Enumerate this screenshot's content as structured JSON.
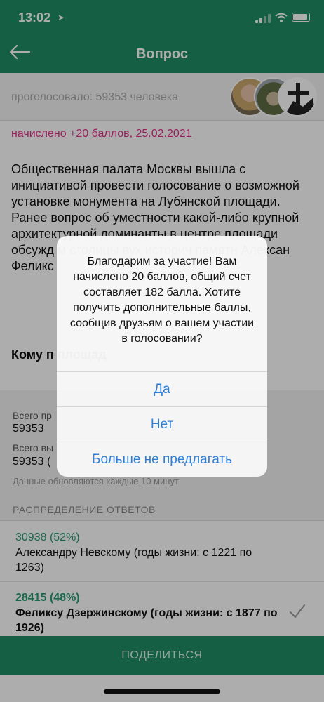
{
  "status": {
    "time": "13:02"
  },
  "nav": {
    "title": "Вопрос"
  },
  "voters": {
    "text": "проголосовало: 59353 человека"
  },
  "points": "начислено +20 баллов, 25.02.2021",
  "question": {
    "text": "Общественная палата Москвы вышла с инициативой провести голосование о возможной установке монумента на Лубянской площади. Ранее вопрос об уместности какой-либо крупной архитектурной доминанты в центре площади обсужд                                     м столицы                                      вух историч памятн Алексан Феликс",
    "bold": "Кому п площад"
  },
  "stats": {
    "label1": "Всего пр",
    "value1": "59353",
    "label2": "Всего вы",
    "value2": "59353 (",
    "note": "Данные обновляются каждые 10 минут"
  },
  "distribution": {
    "header": "РАСПРЕДЕЛЕНИЕ ОТВЕТОВ"
  },
  "answers": [
    {
      "count": "30938 (52%)",
      "text": "Александру Невскому (годы жизни: с 1221 по 1263)",
      "share": 0.52
    },
    {
      "count": "28415 (48%)",
      "text": "Феликсу Дзержинскому (годы жизни: с 1877 по 1926)",
      "share": 0.48
    }
  ],
  "share_button": "ПОДЕЛИТЬСЯ",
  "dialog": {
    "message": "Благодарим за участие! Вам начислено 20 баллов, общий счет составляет 182 балла. Хотите получить дополнительные баллы, сообщив друзьям о вашем участии в голосовании?",
    "yes": "Да",
    "no": "Нет",
    "never": "Больше не предлагать"
  },
  "colors": {
    "brand": "#1f8d65",
    "accent_pink": "#e0308a",
    "link_blue": "#2f7fd7",
    "answer_green": "#2a9a72"
  }
}
